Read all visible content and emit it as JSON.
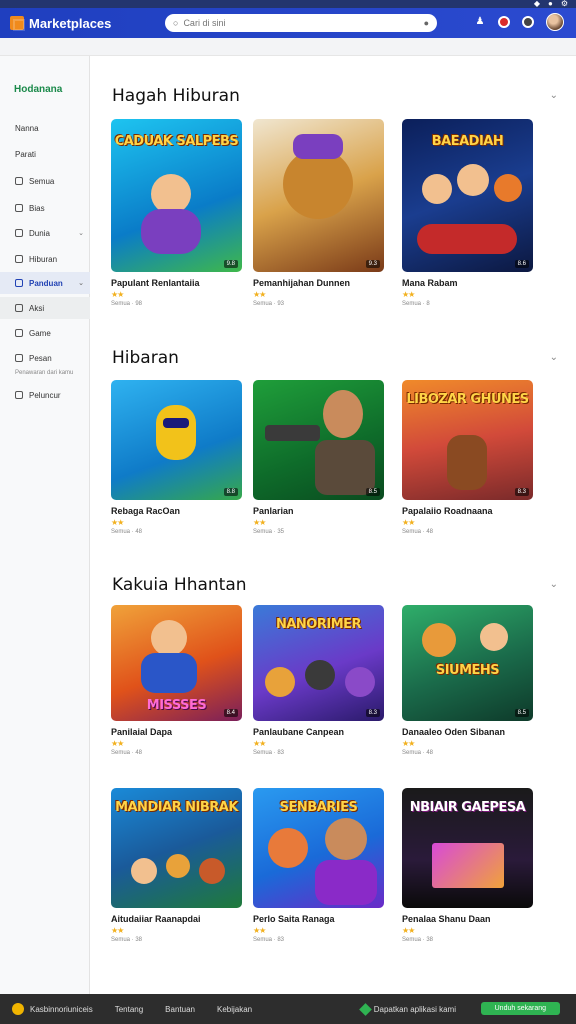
{
  "header": {
    "brand": "Marketplaces",
    "search_placeholder": "Cari di sini"
  },
  "sidebar": {
    "title": "Hodanana",
    "items": [
      {
        "label": "Nanna"
      },
      {
        "label": "Parati"
      },
      {
        "label": "Semua"
      },
      {
        "label": "Bias"
      },
      {
        "label": "Dunia"
      },
      {
        "label": "Hiburan"
      },
      {
        "label": "Panduan"
      },
      {
        "label": "Aksi"
      },
      {
        "label": "Game"
      },
      {
        "label": "Pesan"
      },
      {
        "label": "Peluncur"
      }
    ],
    "sub_note": "Penawaran dari kamu"
  },
  "sections": [
    {
      "title": "Hagah Hiburan",
      "cards": [
        {
          "title": "Papulant Renlantaiia",
          "meta": "Semua · 98",
          "badge": "9.8"
        },
        {
          "title": "Pemanhijahan Dunnen",
          "meta": "Semua · 93",
          "badge": "9.3"
        },
        {
          "title": "Mana Rabam",
          "meta": "Semua · 8",
          "badge": "8.6"
        }
      ]
    },
    {
      "title": "Hibaran",
      "cards": [
        {
          "title": "Rebaga RacOan",
          "meta": "Semua · 48",
          "badge": "8.8"
        },
        {
          "title": "Panlarian",
          "meta": "Semua · 35",
          "badge": "8.5"
        },
        {
          "title": "Papalaiio Roadnaana",
          "meta": "Semua · 48",
          "badge": "8.3"
        }
      ]
    },
    {
      "title": "Kakuia Hhantan",
      "cards": [
        {
          "title": "Panilaial Dapa",
          "meta": "Semua · 48",
          "badge": "8.4"
        },
        {
          "title": "Panlaubane Canpean",
          "meta": "Semua · 83",
          "badge": "8.3"
        },
        {
          "title": "Danaaleo Oden Sibanan",
          "meta": "Semua · 48",
          "badge": "8.5"
        },
        {
          "title": "Aitudaiiar Raanapdai",
          "meta": "Semua · 38",
          "badge": "8.8"
        },
        {
          "title": "Perlo Saita Ranaga",
          "meta": "Semua · 83",
          "badge": "8.3"
        },
        {
          "title": "Penalaa Shanu Daan",
          "meta": "Semua · 38",
          "badge": "8.4"
        }
      ]
    }
  ],
  "art": [
    "CADUAK SALPEBS",
    "",
    "BAEADIAH",
    "",
    "",
    "LIBOZAR GHUNES",
    "MISSSES",
    "NANORIMER",
    "SIUMEHS",
    "MANDIAR NIBRAK",
    "SENBARIES",
    "NBIAIR GAEPESA"
  ],
  "footer": {
    "brand": "Kasbinnoriuniceis",
    "links": [
      "Tentang",
      "Bantuan",
      "Kebijakan"
    ],
    "right_text": "Dapatkan aplikasi kami",
    "button": "Unduh sekarang"
  },
  "colors": {
    "header": "#1f3fbf",
    "accent_green": "#2fb352",
    "star": "#f2b01e"
  }
}
